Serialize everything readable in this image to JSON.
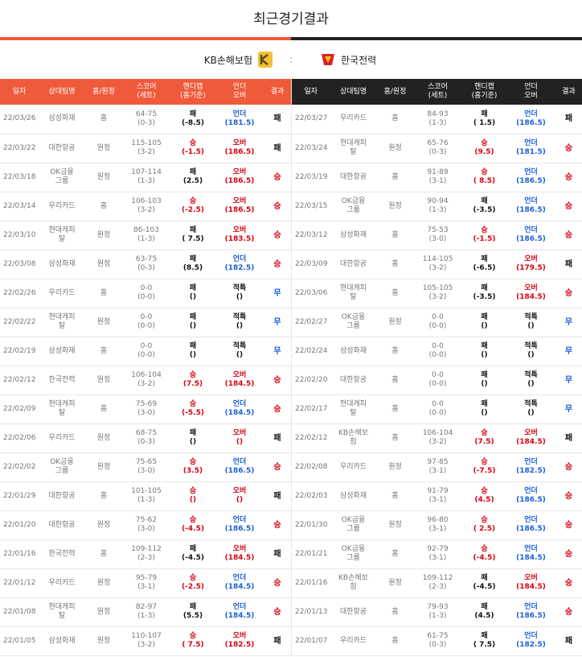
{
  "title": "최근경기결과",
  "teams": {
    "home": "KB손해보험",
    "vs": ":",
    "away": "한국전력"
  },
  "headers": [
    "일자",
    "상대팀명",
    "홈/원정",
    "스코어\n(세트)",
    "핸디캡\n(홈기준)",
    "언더\n오버",
    "결과"
  ],
  "left": [
    {
      "date": "22/03/26",
      "opp": "삼성화재",
      "ha": "홈",
      "score": "64-75",
      "sets": "(0-3)",
      "h": "패",
      "hv": "(-8.5)",
      "o": "언더",
      "ov": "(181.5)",
      "r": "패"
    },
    {
      "date": "22/03/22",
      "opp": "대한항공",
      "ha": "원정",
      "score": "115-105",
      "sets": "(3-2)",
      "h": "승",
      "hv": "(-1.5)",
      "o": "오버",
      "ov": "(186.5)",
      "r": "패"
    },
    {
      "date": "22/03/18",
      "opp": "OK금융\n그룹",
      "ha": "원정",
      "score": "107-114",
      "sets": "(1-3)",
      "h": "패",
      "hv": "(2.5)",
      "o": "오버",
      "ov": "(186.5)",
      "r": "승"
    },
    {
      "date": "22/03/14",
      "opp": "우리카드",
      "ha": "홈",
      "score": "106-103",
      "sets": "(3-2)",
      "h": "승",
      "hv": "(-2.5)",
      "o": "오버",
      "ov": "(186.5)",
      "r": "승"
    },
    {
      "date": "22/03/10",
      "opp": "현대캐피\n탈",
      "ha": "원정",
      "score": "86-103",
      "sets": "(1-3)",
      "h": "패",
      "hv": "( 7.5)",
      "o": "오버",
      "ov": "(183.5)",
      "r": "승"
    },
    {
      "date": "22/03/08",
      "opp": "삼성화재",
      "ha": "원정",
      "score": "63-75",
      "sets": "(0-3)",
      "h": "패",
      "hv": "(8.5)",
      "o": "언더",
      "ov": "(182.5)",
      "r": "승"
    },
    {
      "date": "22/02/26",
      "opp": "우리카드",
      "ha": "홈",
      "score": "0-0",
      "sets": "(0-0)",
      "h": "패",
      "hv": "()",
      "o": "적특",
      "ov": "()",
      "r": "무"
    },
    {
      "date": "22/02/22",
      "opp": "현대캐피\n탈",
      "ha": "원정",
      "score": "0-0",
      "sets": "(0-0)",
      "h": "패",
      "hv": "()",
      "o": "적특",
      "ov": "()",
      "r": "무"
    },
    {
      "date": "22/02/19",
      "opp": "삼성화재",
      "ha": "홈",
      "score": "0-0",
      "sets": "(0-0)",
      "h": "패",
      "hv": "()",
      "o": "적특",
      "ov": "()",
      "r": "무"
    },
    {
      "date": "22/02/12",
      "opp": "한국전력",
      "ha": "원정",
      "score": "106-104",
      "sets": "(3-2)",
      "h": "승",
      "hv": "(7.5)",
      "o": "오버",
      "ov": "(184.5)",
      "r": "승"
    },
    {
      "date": "22/02/09",
      "opp": "현대캐피\n탈",
      "ha": "홈",
      "score": "75-69",
      "sets": "(3-0)",
      "h": "승",
      "hv": "(-5.5)",
      "o": "언더",
      "ov": "(184.5)",
      "r": "승"
    },
    {
      "date": "22/02/06",
      "opp": "우리카드",
      "ha": "원정",
      "score": "68-75",
      "sets": "(0-3)",
      "h": "패",
      "hv": "()",
      "o": "오버",
      "ov": "()",
      "r": "패"
    },
    {
      "date": "22/02/02",
      "opp": "OK금융\n그룹",
      "ha": "원정",
      "score": "75-65",
      "sets": "(3-0)",
      "h": "승",
      "hv": "(3.5)",
      "o": "언더",
      "ov": "(186.5)",
      "r": "승"
    },
    {
      "date": "22/01/29",
      "opp": "대한항공",
      "ha": "홈",
      "score": "101-105",
      "sets": "(1-3)",
      "h": "승",
      "hv": "()",
      "o": "오버",
      "ov": "()",
      "r": "패"
    },
    {
      "date": "22/01/20",
      "opp": "대한항공",
      "ha": "원정",
      "score": "75-62",
      "sets": "(3-0)",
      "h": "승",
      "hv": "(-4.5)",
      "o": "언더",
      "ov": "(186.5)",
      "r": "승"
    },
    {
      "date": "22/01/16",
      "opp": "한국전력",
      "ha": "홈",
      "score": "109-112",
      "sets": "(2-3)",
      "h": "패",
      "hv": "(-4.5)",
      "o": "오버",
      "ov": "(184.5)",
      "r": "패"
    },
    {
      "date": "22/01/12",
      "opp": "우리카드",
      "ha": "원정",
      "score": "95-79",
      "sets": "(3-1)",
      "h": "승",
      "hv": "(-2.5)",
      "o": "언더",
      "ov": "(184.5)",
      "r": "승"
    },
    {
      "date": "22/01/08",
      "opp": "현대캐피\n탈",
      "ha": "원정",
      "score": "82-97",
      "sets": "(1-3)",
      "h": "패",
      "hv": "(5.5)",
      "o": "언더",
      "ov": "(184.5)",
      "r": "승"
    },
    {
      "date": "22/01/05",
      "opp": "삼성화재",
      "ha": "원정",
      "score": "110-107",
      "sets": "(3-2)",
      "h": "승",
      "hv": "( 7.5)",
      "o": "오버",
      "ov": "(182.5)",
      "r": "패"
    }
  ],
  "right": [
    {
      "date": "22/03/27",
      "opp": "우리카드",
      "ha": "홈",
      "score": "84-93",
      "sets": "(1-3)",
      "h": "패",
      "hv": "( 1.5)",
      "o": "언더",
      "ov": "(186.5)",
      "r": "패"
    },
    {
      "date": "22/03/24",
      "opp": "현대캐피\n탈",
      "ha": "원정",
      "score": "65-76",
      "sets": "(0-3)",
      "h": "승",
      "hv": "(9.5)",
      "o": "언더",
      "ov": "(181.5)",
      "r": "승"
    },
    {
      "date": "22/03/19",
      "opp": "대한항공",
      "ha": "홈",
      "score": "91-89",
      "sets": "(3-1)",
      "h": "승",
      "hv": "( 8.5)",
      "o": "언더",
      "ov": "(186.5)",
      "r": "승"
    },
    {
      "date": "22/03/15",
      "opp": "OK금융\n그룹",
      "ha": "원정",
      "score": "90-94",
      "sets": "(1-3)",
      "h": "패",
      "hv": "(-3.5)",
      "o": "언더",
      "ov": "(186.5)",
      "r": "승"
    },
    {
      "date": "22/03/12",
      "opp": "삼성화재",
      "ha": "홈",
      "score": "75-53",
      "sets": "(3-0)",
      "h": "승",
      "hv": "(-1.5)",
      "o": "언더",
      "ov": "(186.5)",
      "r": "승"
    },
    {
      "date": "22/03/09",
      "opp": "대한항공",
      "ha": "홈",
      "score": "114-105",
      "sets": "(3-2)",
      "h": "패",
      "hv": "(-6.5)",
      "o": "오버",
      "ov": "(179.5)",
      "r": "패"
    },
    {
      "date": "22/03/06",
      "opp": "현대캐피\n탈",
      "ha": "홈",
      "score": "105-105",
      "sets": "(3-2)",
      "h": "패",
      "hv": "(-3.5)",
      "o": "오버",
      "ov": "(184.5)",
      "r": "승"
    },
    {
      "date": "22/02/27",
      "opp": "OK금융\n그룹",
      "ha": "원정",
      "score": "0-0",
      "sets": "(0-0)",
      "h": "패",
      "hv": "()",
      "o": "적특",
      "ov": "()",
      "r": "무"
    },
    {
      "date": "22/02/24",
      "opp": "삼성화재",
      "ha": "홈",
      "score": "0-0",
      "sets": "(0-0)",
      "h": "패",
      "hv": "()",
      "o": "적특",
      "ov": "()",
      "r": "무"
    },
    {
      "date": "22/02/20",
      "opp": "대한항공",
      "ha": "홈",
      "score": "0-0",
      "sets": "(0-0)",
      "h": "패",
      "hv": "()",
      "o": "적특",
      "ov": "()",
      "r": "무"
    },
    {
      "date": "22/02/17",
      "opp": "현대캐피\n탈",
      "ha": "홈",
      "score": "0-0",
      "sets": "(0-0)",
      "h": "패",
      "hv": "()",
      "o": "적특",
      "ov": "()",
      "r": "무"
    },
    {
      "date": "22/02/12",
      "opp": "KB손해보\n험",
      "ha": "홈",
      "score": "106-104",
      "sets": "(3-2)",
      "h": "승",
      "hv": "(7.5)",
      "o": "오버",
      "ov": "(184.5)",
      "r": "패"
    },
    {
      "date": "22/02/08",
      "opp": "우리카드",
      "ha": "원정",
      "score": "97-85",
      "sets": "(3-1)",
      "h": "승",
      "hv": "(-7.5)",
      "o": "언더",
      "ov": "(182.5)",
      "r": "승"
    },
    {
      "date": "22/02/03",
      "opp": "삼성화재",
      "ha": "홈",
      "score": "91-79",
      "sets": "(3-1)",
      "h": "승",
      "hv": "(4.5)",
      "o": "언더",
      "ov": "(186.5)",
      "r": "승"
    },
    {
      "date": "22/01/30",
      "opp": "OK금융\n그룹",
      "ha": "원정",
      "score": "96-80",
      "sets": "(3-1)",
      "h": "승",
      "hv": "( 2.5)",
      "o": "언더",
      "ov": "(186.5)",
      "r": "승"
    },
    {
      "date": "22/01/21",
      "opp": "OK금융\n그룹",
      "ha": "홈",
      "score": "92-79",
      "sets": "(3-1)",
      "h": "승",
      "hv": "(-4.5)",
      "o": "언더",
      "ov": "(184.5)",
      "r": "승"
    },
    {
      "date": "22/01/16",
      "opp": "KB손해보\n험",
      "ha": "원정",
      "score": "109-112",
      "sets": "(2-3)",
      "h": "패",
      "hv": "(-4.5)",
      "o": "오버",
      "ov": "(184.5)",
      "r": "승"
    },
    {
      "date": "22/01/13",
      "opp": "대한항공",
      "ha": "홈",
      "score": "79-93",
      "sets": "(1-3)",
      "h": "패",
      "hv": "(4.5)",
      "o": "언더",
      "ov": "(186.5)",
      "r": "승"
    },
    {
      "date": "22/01/07",
      "opp": "우리카드",
      "ha": "홈",
      "score": "61-75",
      "sets": "(0-3)",
      "h": "패",
      "hv": "( 7.5)",
      "o": "언더",
      "ov": "(182.5)",
      "r": "패"
    }
  ]
}
